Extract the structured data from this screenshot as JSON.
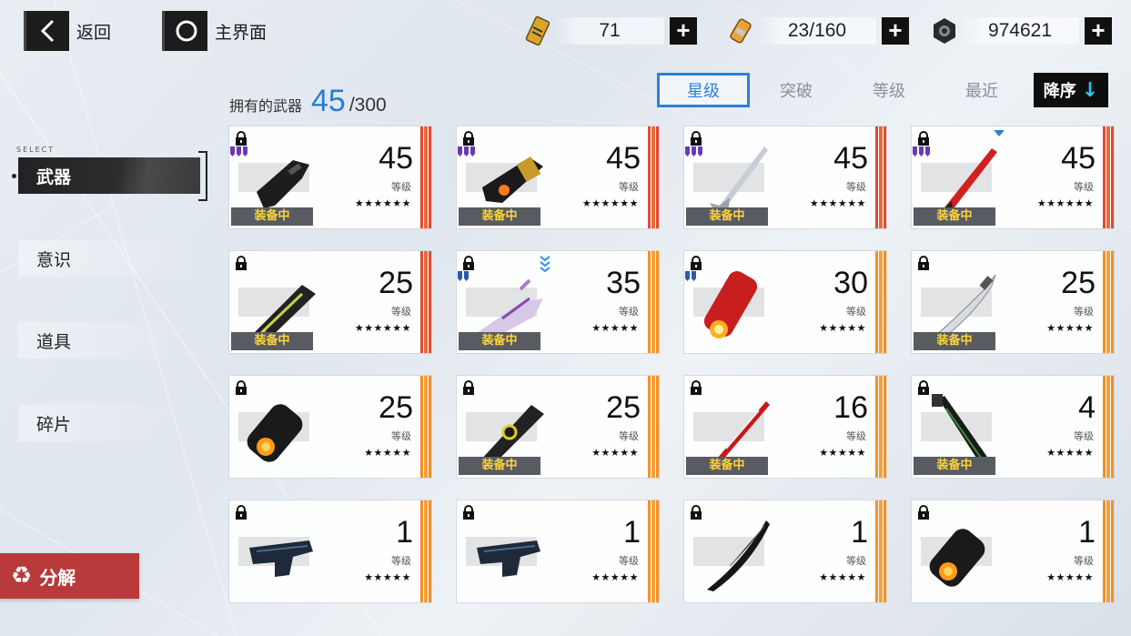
{
  "topbar": {
    "back_label": "返回",
    "home_label": "主界面"
  },
  "resources": [
    {
      "name": "gold-card-icon",
      "value": "71"
    },
    {
      "name": "battery-icon",
      "value": "23/160"
    },
    {
      "name": "gear-nut-icon",
      "value": "974621"
    }
  ],
  "sort": {
    "tabs": [
      "星级",
      "突破",
      "等级",
      "最近"
    ],
    "active": "星级",
    "order_label": "降序"
  },
  "owned": {
    "label": "拥有的武器",
    "count": "45",
    "total": "/300"
  },
  "nav": {
    "select_label": "SELECT",
    "items": [
      "武器",
      "意识",
      "道具",
      "碎片"
    ],
    "active": "武器"
  },
  "salvage_label": "分解",
  "level_label": "等级",
  "equipped_label": "装备中",
  "weapons": [
    {
      "level": "45",
      "stars": "★★★★★★",
      "equipped": true,
      "stripe": "red",
      "rank": "purple",
      "type": "gun"
    },
    {
      "level": "45",
      "stars": "★★★★★★",
      "equipped": true,
      "stripe": "red",
      "rank": "purple",
      "type": "gauntlet"
    },
    {
      "level": "45",
      "stars": "★★★★★★",
      "equipped": true,
      "stripe": "red",
      "rank": "purple",
      "type": "lance"
    },
    {
      "level": "45",
      "stars": "★★★★★★",
      "equipped": true,
      "stripe": "red",
      "rank": "purple",
      "type": "redblade"
    },
    {
      "level": "25",
      "stars": "★★★★★★",
      "equipped": true,
      "stripe": "red",
      "rank": "",
      "type": "chainsaw"
    },
    {
      "level": "35",
      "stars": "★★★★★",
      "equipped": true,
      "stripe": "orange",
      "rank": "blue",
      "type": "pinkgun"
    },
    {
      "level": "30",
      "stars": "★★★★★",
      "equipped": false,
      "stripe": "orange",
      "rank": "blue",
      "type": "cannon"
    },
    {
      "level": "25",
      "stars": "★★★★★",
      "equipped": true,
      "stripe": "orange",
      "rank": "",
      "type": "scimitar"
    },
    {
      "level": "25",
      "stars": "★★★★★",
      "equipped": false,
      "stripe": "orange",
      "rank": "",
      "type": "gauntlet2"
    },
    {
      "level": "25",
      "stars": "★★★★★",
      "equipped": true,
      "stripe": "orange",
      "rank": "",
      "type": "chainsaw2"
    },
    {
      "level": "16",
      "stars": "★★★★★",
      "equipped": true,
      "stripe": "orange",
      "rank": "",
      "type": "katana"
    },
    {
      "level": "4",
      "stars": "★★★★★",
      "equipped": true,
      "stripe": "orange",
      "rank": "",
      "type": "greatsword"
    },
    {
      "level": "1",
      "stars": "★★★★★",
      "equipped": false,
      "stripe": "orange",
      "rank": "",
      "type": "pistol"
    },
    {
      "level": "1",
      "stars": "★★★★★",
      "equipped": false,
      "stripe": "orange",
      "rank": "",
      "type": "pistol"
    },
    {
      "level": "1",
      "stars": "★★★★★",
      "equipped": false,
      "stripe": "orange",
      "rank": "",
      "type": "darkblade"
    },
    {
      "level": "1",
      "stars": "★★★★★",
      "equipped": false,
      "stripe": "orange",
      "rank": "",
      "type": "gauntlet2"
    }
  ]
}
